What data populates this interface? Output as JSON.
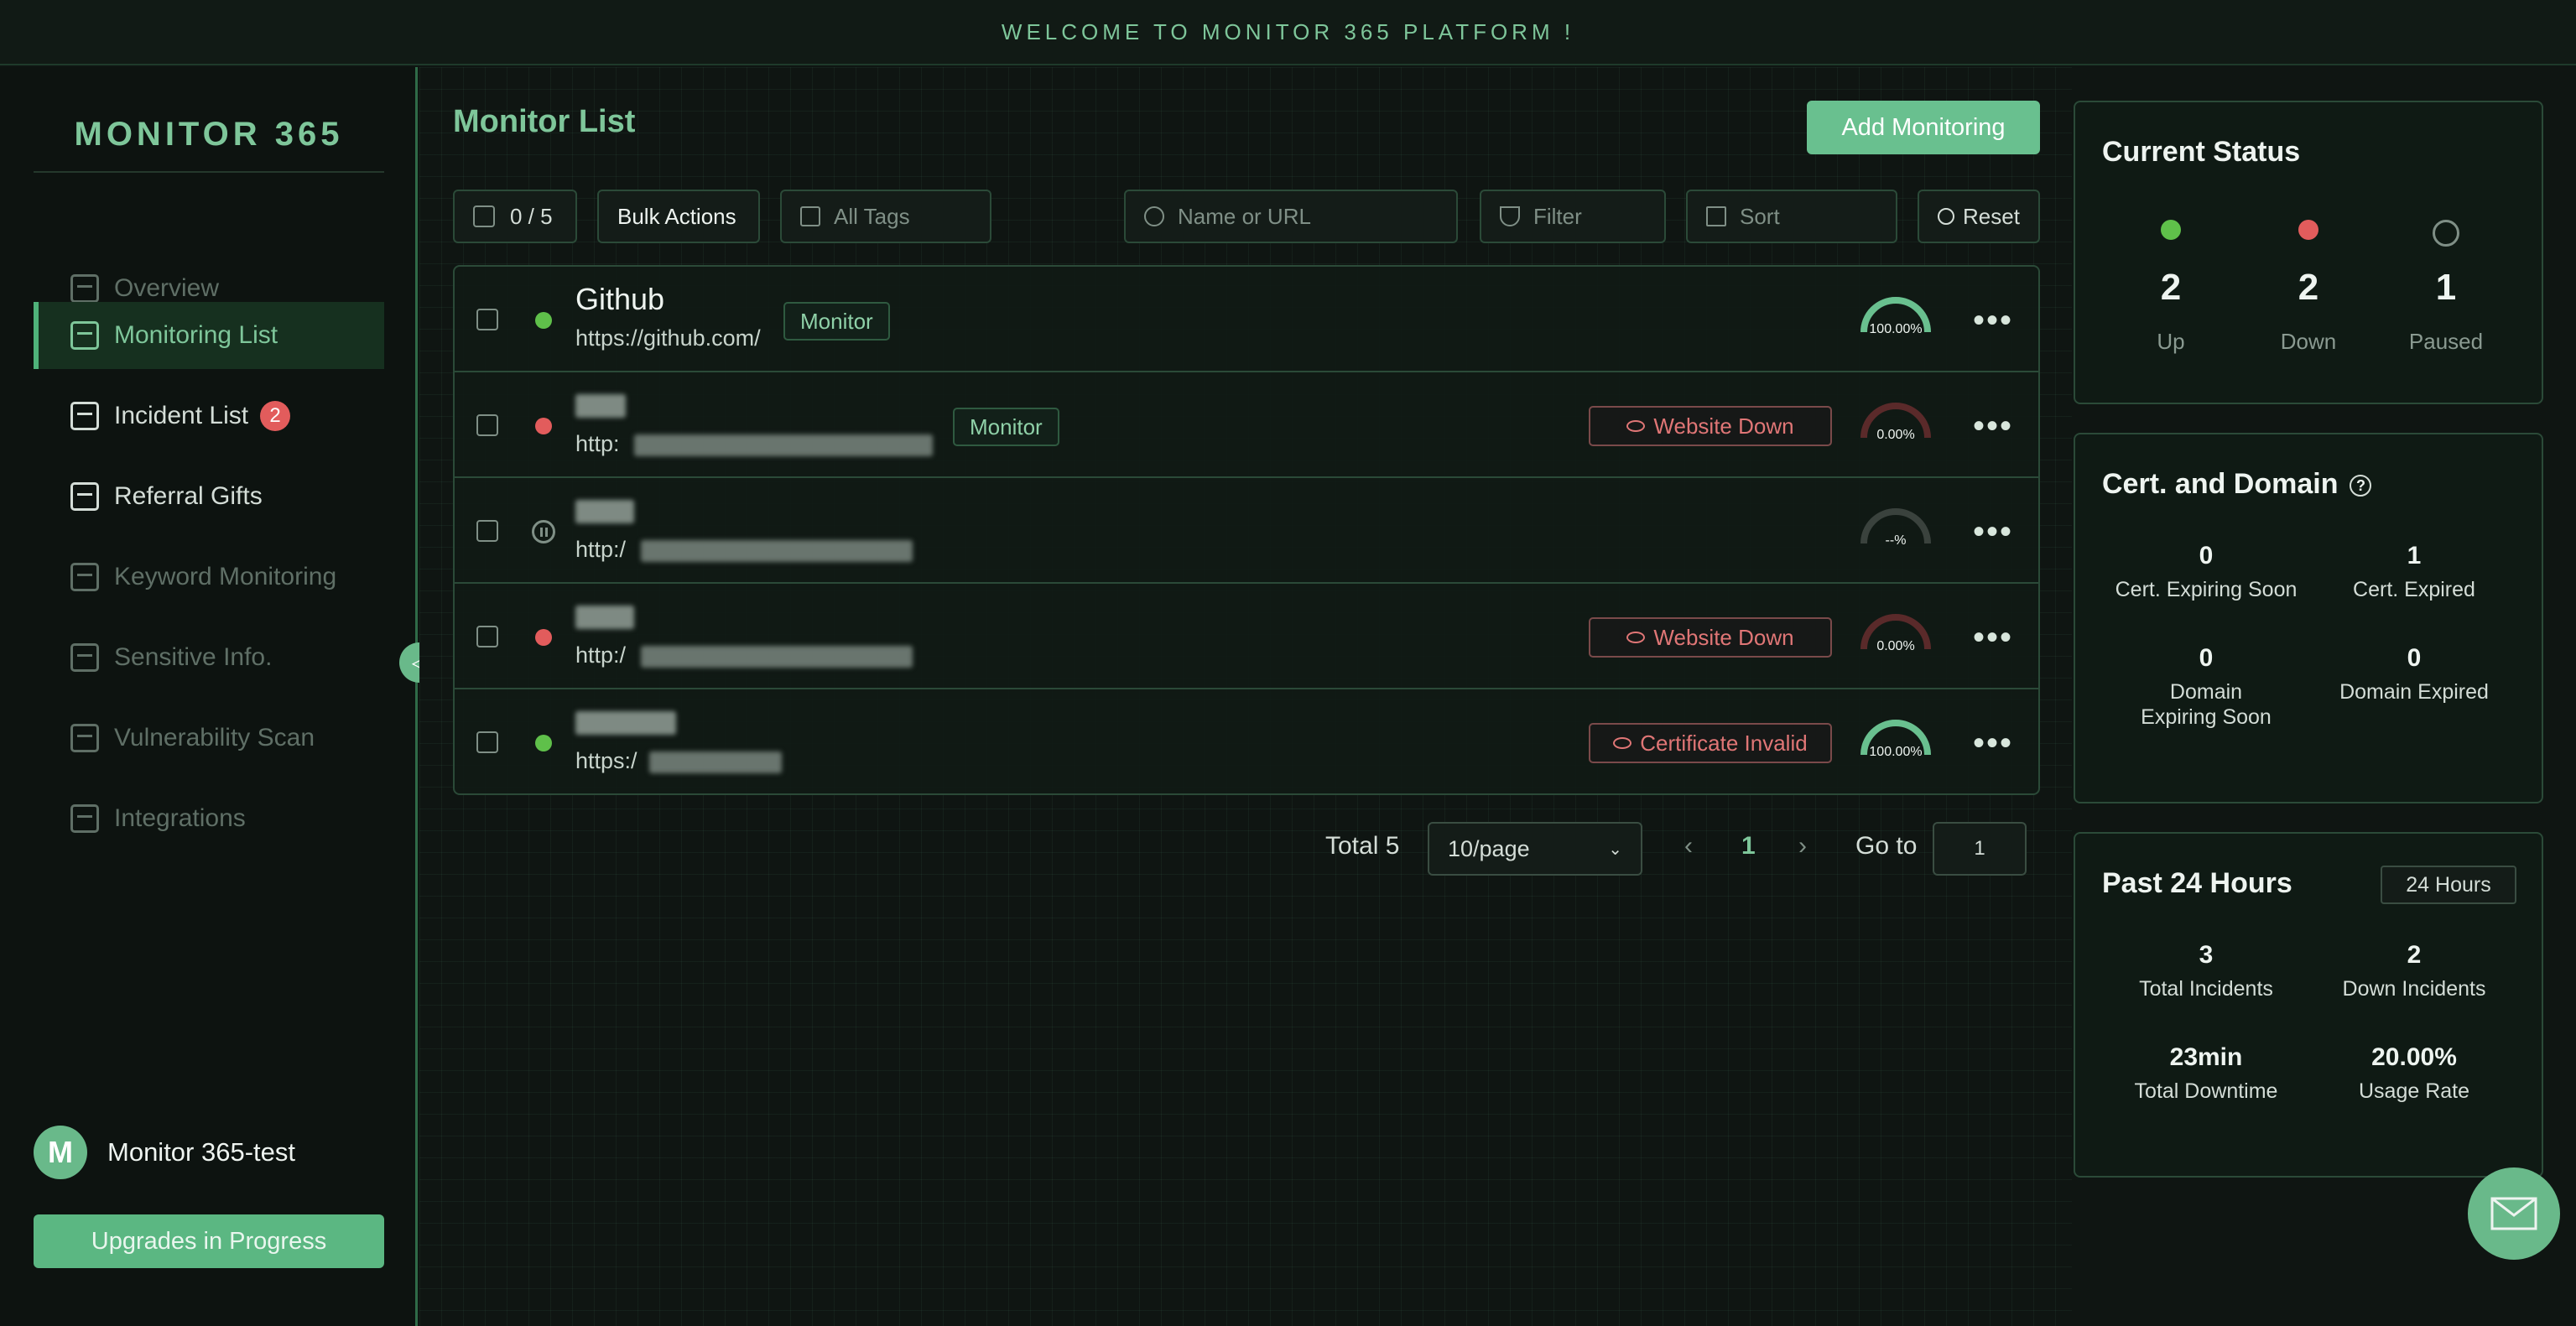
{
  "banner": {
    "text": "WELCOME TO MONITOR 365 PLATFORM !"
  },
  "sidebar": {
    "brand": "MONITOR 365",
    "items": [
      {
        "label": "Overview",
        "icon": "dashboard-icon"
      },
      {
        "label": "Monitoring List",
        "icon": "chart-icon"
      },
      {
        "label": "Incident List",
        "icon": "list-icon",
        "badge": "2"
      },
      {
        "label": "Referral Gifts",
        "icon": "gift-icon"
      },
      {
        "label": "Keyword Monitoring",
        "icon": "keyword-icon"
      },
      {
        "label": "Sensitive Info.",
        "icon": "shield-icon"
      },
      {
        "label": "Vulnerability Scan",
        "icon": "scan-icon"
      },
      {
        "label": "Integrations",
        "icon": "integration-icon"
      }
    ],
    "user": {
      "initial": "M",
      "name": "Monitor 365-test"
    },
    "upgrade_button": "Upgrades in Progress"
  },
  "main": {
    "title": "Monitor List",
    "add_button": "Add Monitoring",
    "toolbar": {
      "selection": "0 / 5",
      "bulk_actions": "Bulk Actions",
      "tags_placeholder": "All Tags",
      "search_placeholder": "Name or URL",
      "filter": "Filter",
      "sort": "Sort",
      "reset": "Reset"
    },
    "monitors": [
      {
        "name": "Github",
        "url": "https://github.com/",
        "status": "up",
        "tag": "Monitor",
        "alert": "",
        "uptime": "100.00%",
        "uptime_value": 100,
        "gauge_color": "#69c08f"
      },
      {
        "name": "",
        "url": "http:",
        "status": "down",
        "tag": "Monitor",
        "alert": "Website Down",
        "uptime": "0.00%",
        "uptime_value": 0,
        "gauge_color": "#6e2e2e"
      },
      {
        "name": "",
        "url": "http:/",
        "status": "paused",
        "tag": "",
        "alert": "",
        "uptime": "--%",
        "uptime_value": 0,
        "gauge_color": "#4a524d"
      },
      {
        "name": "",
        "url": "http:/",
        "status": "down",
        "tag": "",
        "alert": "Website Down",
        "uptime": "0.00%",
        "uptime_value": 0,
        "gauge_color": "#6e2e2e"
      },
      {
        "name": "",
        "url": "https:/",
        "status": "up",
        "tag": "",
        "alert": "Certificate Invalid",
        "uptime": "100.00%",
        "uptime_value": 100,
        "gauge_color": "#69c08f"
      }
    ],
    "pagination": {
      "total": "Total 5",
      "page_size": "10/page",
      "current_page": "1",
      "goto_label": "Go to",
      "goto_value": "1"
    }
  },
  "status_panel": {
    "title": "Current Status",
    "items": [
      {
        "count": "2",
        "label": "Up",
        "color": "#5fc04a"
      },
      {
        "count": "2",
        "label": "Down",
        "color": "#e25c5c"
      },
      {
        "count": "1",
        "label": "Paused",
        "color": "#7f8f86"
      }
    ]
  },
  "cert_panel": {
    "title": "Cert. and Domain",
    "metrics": [
      {
        "value": "0",
        "label": "Cert. Expiring Soon"
      },
      {
        "value": "1",
        "label": "Cert. Expired"
      },
      {
        "value": "0",
        "label": "Domain Expiring Soon"
      },
      {
        "value": "0",
        "label": "Domain Expired"
      }
    ]
  },
  "past_panel": {
    "title": "Past 24 Hours",
    "range": "24 Hours",
    "metrics": [
      {
        "value": "3",
        "label": "Total Incidents"
      },
      {
        "value": "2",
        "label": "Down Incidents"
      },
      {
        "value": "23min",
        "label": "Total Downtime"
      },
      {
        "value": "20.00%",
        "label": "Usage Rate"
      }
    ]
  },
  "colors": {
    "accent": "#69c08f",
    "down": "#e25c5c",
    "up": "#5fc04a",
    "background": "#0f1512"
  }
}
